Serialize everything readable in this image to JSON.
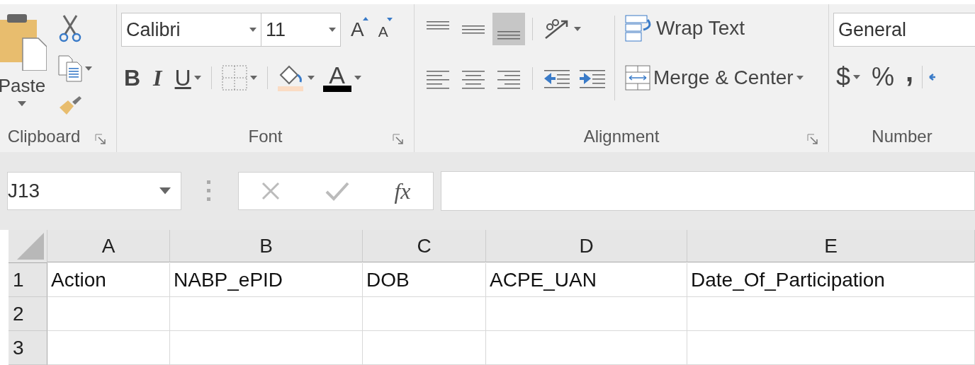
{
  "ribbon": {
    "clipboard": {
      "label": "Clipboard",
      "paste": "Paste"
    },
    "font": {
      "label": "Font",
      "font_name": "Calibri",
      "font_size": "11",
      "grow": "A",
      "shrink": "A",
      "bold": "B",
      "italic": "I",
      "underline": "U",
      "font_color": "A"
    },
    "alignment": {
      "label": "Alignment",
      "vertical": [
        {
          "kind": "top",
          "selected": false
        },
        {
          "kind": "middle",
          "selected": false
        },
        {
          "kind": "bottom",
          "selected": true
        }
      ],
      "horizontal": [
        {
          "kind": "left"
        },
        {
          "kind": "center"
        },
        {
          "kind": "right"
        }
      ],
      "wrap_text": "Wrap Text",
      "merge": "Merge & Center"
    },
    "number": {
      "label": "Number",
      "format": "General",
      "currency": "$",
      "percent": "%",
      "comma": ","
    }
  },
  "formula_bar": {
    "name_box": "J13",
    "fx": "fx"
  },
  "sheet": {
    "columns": [
      "A",
      "B",
      "C",
      "D",
      "E"
    ],
    "rows": [
      {
        "header": "1",
        "cells": [
          "Action",
          "NABP_ePID",
          "DOB",
          "ACPE_UAN",
          "Date_Of_Participation"
        ]
      },
      {
        "header": "2",
        "cells": [
          "",
          "",
          "",
          "",
          ""
        ]
      },
      {
        "header": "3",
        "cells": [
          "",
          "",
          "",
          "",
          ""
        ]
      }
    ]
  }
}
